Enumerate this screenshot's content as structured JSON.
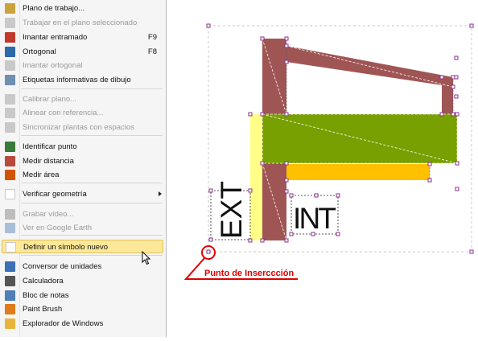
{
  "menu": {
    "items": [
      {
        "label": "Plano de trabajo...",
        "shortcut": "",
        "disabled": false,
        "icon": "pencil-icon",
        "color": "#caa33c"
      },
      {
        "label": "Trabajar en el plano seleccionado",
        "shortcut": "",
        "disabled": true,
        "icon": "plane-icon",
        "color": "#c9c9c9"
      },
      {
        "label": "Imantar entramado",
        "shortcut": "F9",
        "disabled": false,
        "icon": "magnet-grid-icon",
        "color": "#c0392b"
      },
      {
        "label": "Ortogonal",
        "shortcut": "F8",
        "disabled": false,
        "icon": "orthogonal-icon",
        "color": "#2d6aa8"
      },
      {
        "label": "Imantar ortogonal",
        "shortcut": "",
        "disabled": true,
        "icon": "magnet-ortho-icon",
        "color": "#c9c9c9"
      },
      {
        "label": "Etiquetas informativas de dibujo",
        "shortcut": "",
        "disabled": false,
        "icon": "label-icon",
        "color": "#6f8fb3"
      },
      {
        "label": "Calibrar plano...",
        "shortcut": "",
        "disabled": true,
        "icon": "calibrate-icon",
        "color": "#c9c9c9"
      },
      {
        "label": "Alinear con referencia...",
        "shortcut": "",
        "disabled": true,
        "icon": "align-icon",
        "color": "#c9c9c9"
      },
      {
        "label": "Sincronizar plantas con espacios",
        "shortcut": "",
        "disabled": true,
        "icon": "sync-icon",
        "color": "#c9c9c9"
      },
      {
        "label": "Identificar punto",
        "shortcut": "",
        "disabled": false,
        "icon": "point-icon",
        "color": "#3a7a3a"
      },
      {
        "label": "Medir distancia",
        "shortcut": "",
        "disabled": false,
        "icon": "ruler-icon",
        "color": "#b94a3a"
      },
      {
        "label": "Medir área",
        "shortcut": "",
        "disabled": false,
        "icon": "area-icon",
        "color": "#d35400"
      },
      {
        "label": "Verificar geometría",
        "shortcut": "",
        "disabled": false,
        "icon": "verify-icon",
        "color": "#ffffff",
        "submenu": true
      },
      {
        "label": "Grabar vídeo...",
        "shortcut": "",
        "disabled": true,
        "icon": "video-icon",
        "color": "#bdbdbd"
      },
      {
        "label": "Ver en Google Earth",
        "shortcut": "",
        "disabled": true,
        "icon": "earth-icon",
        "color": "#a9bfd9"
      },
      {
        "label": "Definir un símbolo nuevo",
        "shortcut": "",
        "disabled": false,
        "icon": "symbol-icon",
        "color": "#ffffff",
        "highlighted": true
      },
      {
        "label": "Conversor de unidades",
        "shortcut": "",
        "disabled": false,
        "icon": "converter-icon",
        "color": "#3b6fb6"
      },
      {
        "label": "Calculadora",
        "shortcut": "",
        "disabled": false,
        "icon": "calculator-icon",
        "color": "#555555"
      },
      {
        "label": "Bloc de notas",
        "shortcut": "",
        "disabled": false,
        "icon": "notepad-icon",
        "color": "#4f7fb8"
      },
      {
        "label": "Paint Brush",
        "shortcut": "",
        "disabled": false,
        "icon": "paint-icon",
        "color": "#e07b1a"
      },
      {
        "label": "Explorador de Windows",
        "shortcut": "",
        "disabled": false,
        "icon": "folder-icon",
        "color": "#e8b43a"
      }
    ]
  },
  "drawing": {
    "text_ext": "EXT",
    "text_int": "INT",
    "annotation": "Punto de Inserccción",
    "colors": {
      "brown": "#a05555",
      "green": "#77a000",
      "orange": "#ffc000",
      "light_yellow": "#ffff88",
      "annotation": "#e00000",
      "handle": "#8b2f8b"
    }
  }
}
